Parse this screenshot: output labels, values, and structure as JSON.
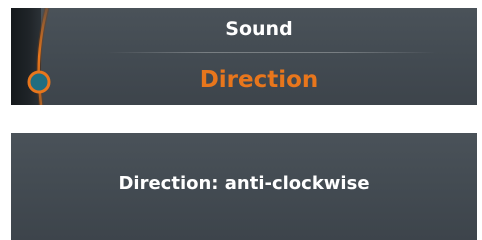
{
  "menu": {
    "items": [
      {
        "label": "Sound",
        "selected": false
      },
      {
        "label": "Direction",
        "selected": true
      }
    ]
  },
  "status": {
    "text": "Direction: anti-clockwise"
  },
  "colors": {
    "accent": "#e8761c",
    "knob_fill": "#1f6d80",
    "panel_bg": "#454d54",
    "text": "#ffffff"
  },
  "icons": {
    "selector_arc": "selector-arc-icon",
    "selector_knob": "selector-knob-icon"
  }
}
